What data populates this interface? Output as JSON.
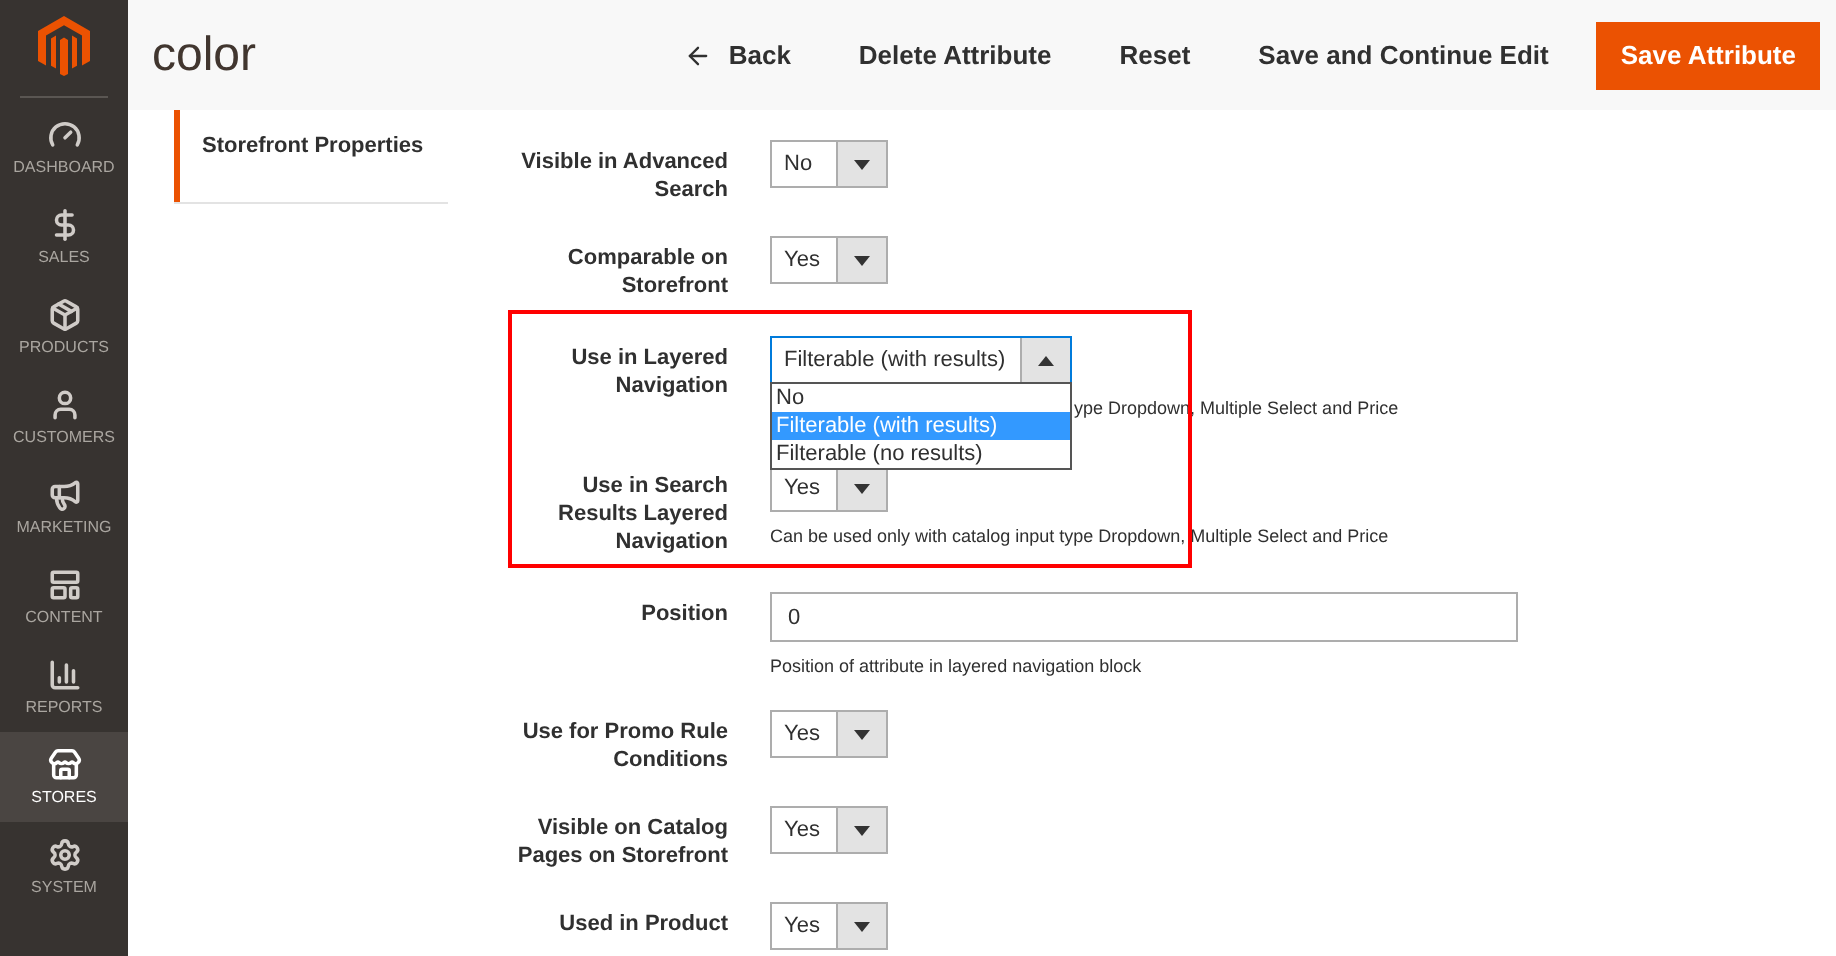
{
  "sidebar": {
    "items": [
      {
        "label": "DASHBOARD",
        "selected": false
      },
      {
        "label": "SALES",
        "selected": false
      },
      {
        "label": "PRODUCTS",
        "selected": false
      },
      {
        "label": "CUSTOMERS",
        "selected": false
      },
      {
        "label": "MARKETING",
        "selected": false
      },
      {
        "label": "CONTENT",
        "selected": false
      },
      {
        "label": "REPORTS",
        "selected": false
      },
      {
        "label": "STORES",
        "selected": true
      },
      {
        "label": "SYSTEM",
        "selected": false
      }
    ]
  },
  "header": {
    "title": "color",
    "actions": [
      {
        "label": "Back",
        "kind": "back"
      },
      {
        "label": "Delete Attribute",
        "kind": "plain"
      },
      {
        "label": "Reset",
        "kind": "plain"
      },
      {
        "label": "Save and Continue Edit",
        "kind": "plain"
      },
      {
        "label": "Save Attribute",
        "kind": "primary"
      }
    ]
  },
  "tabs": [
    {
      "label": "Storefront Properties",
      "selected": true
    }
  ],
  "form": {
    "rows": [
      {
        "kind": "select",
        "label": "Visible in Advanced Search",
        "value": "No",
        "expanded": false,
        "highlighted": false
      },
      {
        "kind": "select",
        "label": "Comparable on Storefront",
        "value": "Yes",
        "expanded": false,
        "highlighted": false
      },
      {
        "kind": "select",
        "label": "Use in Layered Navigation",
        "value": "Filterable (with results)",
        "expanded": true,
        "note": "ype Dropdown, Multiple Select and Price",
        "highlighted": true,
        "options": [
          {
            "label": "No",
            "selected": false
          },
          {
            "label": "Filterable (with results)",
            "selected": true
          },
          {
            "label": "Filterable (no results)",
            "selected": false
          }
        ]
      },
      {
        "kind": "select",
        "label": "Use in Search Results Layered Navigation",
        "value": "Yes",
        "expanded": false,
        "note": "Can be used only with catalog input type Dropdown, Multiple Select and Price",
        "highlighted": true
      },
      {
        "kind": "input",
        "label": "Position",
        "value": "0",
        "note": "Position of attribute in layered navigation block",
        "highlighted": false
      },
      {
        "kind": "select",
        "label": "Use for Promo Rule Conditions",
        "value": "Yes",
        "expanded": false,
        "highlighted": false
      },
      {
        "kind": "select",
        "label": "Visible on Catalog Pages on Storefront",
        "value": "Yes",
        "expanded": false,
        "highlighted": false
      },
      {
        "kind": "select",
        "label": "Used in Product",
        "value": "Yes",
        "expanded": false,
        "highlighted": false
      }
    ]
  }
}
